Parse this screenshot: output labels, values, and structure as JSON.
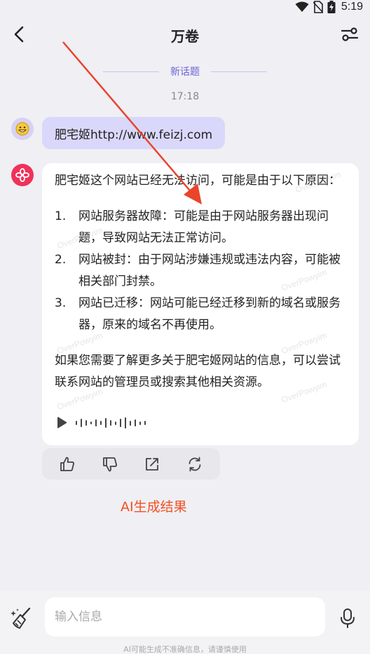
{
  "status_bar": {
    "time": "5:19"
  },
  "header": {
    "title": "万卷"
  },
  "conversation": {
    "topic_label": "新话题",
    "timestamp": "17:18",
    "user_message": "肥宅姬http://www.feizj.com",
    "ai_message": {
      "intro": "肥宅姬这个网站已经无法访问，可能是由于以下原因：",
      "items": [
        {
          "num": "1.",
          "text": "网站服务器故障：可能是由于网站服务器出现问题，导致网站无法正常访问。"
        },
        {
          "num": "2.",
          "text": "网站被封：由于网站涉嫌违规或违法内容，可能被相关部门封禁。"
        },
        {
          "num": "3.",
          "text": "网站已迁移：网站可能已经迁移到新的域名或服务器，原来的域名不再使用。"
        }
      ],
      "outro": "如果您需要了解更多关于肥宅姬网站的信息，可以尝试联系网站的管理员或搜索其他相关资源。",
      "watermark": "OverPowyim"
    }
  },
  "annotation_label": "AI生成结果",
  "input": {
    "placeholder": "输入信息"
  },
  "disclaimer": "AI可能生成不准确信息，请谨慎使用",
  "colors": {
    "accent": "#6b63d6",
    "user_bubble": "#d9d8fb",
    "ai_avatar": "#f0315b",
    "annotation": "#f25022"
  }
}
